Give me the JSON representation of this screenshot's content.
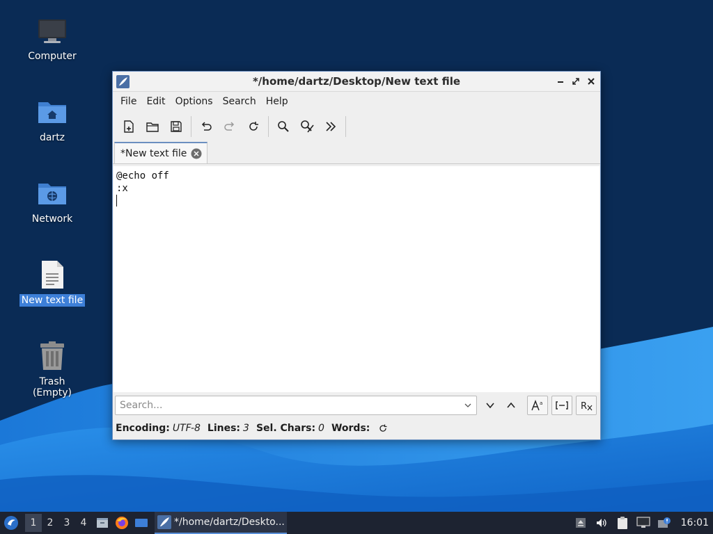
{
  "desktop": {
    "icons": [
      {
        "label": "Computer",
        "icon": "monitor-icon",
        "selected": false
      },
      {
        "label": "dartz",
        "icon": "home-folder-icon",
        "selected": false
      },
      {
        "label": "Network",
        "icon": "network-folder-icon",
        "selected": false
      },
      {
        "label": "New text file",
        "icon": "text-file-icon",
        "selected": true
      },
      {
        "label": "Trash (Empty)",
        "icon": "trash-icon",
        "selected": false
      }
    ]
  },
  "window": {
    "title": "*/home/dartz/Desktop/New text file",
    "menus": [
      "File",
      "Edit",
      "Options",
      "Search",
      "Help"
    ],
    "toolbar": [
      "new-document-icon",
      "open-folder-icon",
      "save-icon",
      "undo-icon",
      "redo-icon",
      "reload-icon",
      "find-icon",
      "replace-icon",
      "more-icon"
    ],
    "tab_label": "*New text file",
    "editor_lines": [
      "@echo off",
      ":x",
      ""
    ],
    "search": {
      "placeholder": "Search..."
    },
    "status": {
      "encoding_key": "Encoding:",
      "encoding_value": "UTF-8",
      "lines_key": "Lines:",
      "lines_value": "3",
      "sel_key": "Sel. Chars:",
      "sel_value": "0",
      "words_key": "Words:"
    }
  },
  "taskbar": {
    "workspaces": [
      "1",
      "2",
      "3",
      "4"
    ],
    "active_workspace": "1",
    "task_title": "*/home/dartz/Deskto...",
    "clock": "16:01"
  },
  "colors": {
    "accent": "#3d7fd8",
    "taskbar": "#1d2331",
    "desktop": "#0a2b55"
  }
}
